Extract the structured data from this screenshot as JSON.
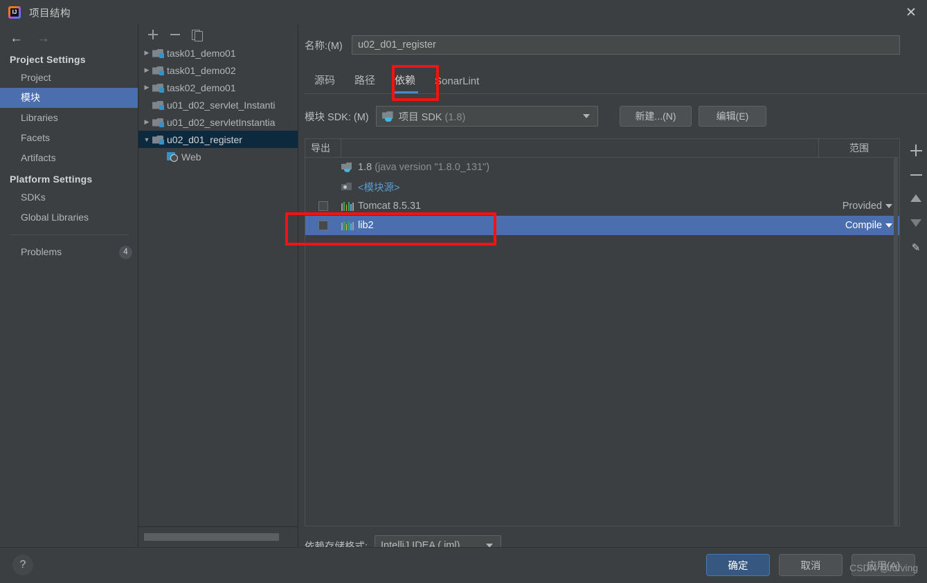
{
  "window": {
    "title": "项目结构",
    "logo_icon": "intellij-idea-logo",
    "close_icon": "close-icon"
  },
  "leftnav": {
    "back_icon": "arrow-left-icon",
    "forward_icon": "arrow-right-icon",
    "groups": [
      {
        "title": "Project Settings",
        "items": [
          {
            "label": "Project",
            "selected": false
          },
          {
            "label": "模块",
            "selected": true
          },
          {
            "label": "Libraries",
            "selected": false
          },
          {
            "label": "Facets",
            "selected": false
          },
          {
            "label": "Artifacts",
            "selected": false
          }
        ]
      },
      {
        "title": "Platform Settings",
        "items": [
          {
            "label": "SDKs",
            "selected": false
          },
          {
            "label": "Global Libraries",
            "selected": false
          }
        ]
      }
    ],
    "problems": {
      "label": "Problems",
      "count": "4"
    }
  },
  "tree": {
    "toolbar": {
      "add_icon": "plus-icon",
      "remove_icon": "minus-icon",
      "copy_icon": "copy-icon"
    },
    "rows": [
      {
        "label": "task01_demo01",
        "icon": "module-icon",
        "twisty": "▶",
        "indent": 0,
        "selected": false
      },
      {
        "label": "task01_demo02",
        "icon": "module-icon",
        "twisty": "▶",
        "indent": 0,
        "selected": false
      },
      {
        "label": "task02_demo01",
        "icon": "module-icon",
        "twisty": "▶",
        "indent": 0,
        "selected": false
      },
      {
        "label": "u01_d02_servlet_Instanti",
        "icon": "module-icon",
        "twisty": "",
        "indent": 0,
        "selected": false
      },
      {
        "label": "u01_d02_servletInstantia",
        "icon": "module-icon",
        "twisty": "▶",
        "indent": 0,
        "selected": false
      },
      {
        "label": "u02_d01_register",
        "icon": "module-icon",
        "twisty": "▼",
        "indent": 0,
        "selected": true
      },
      {
        "label": "Web",
        "icon": "web-facet-icon",
        "twisty": "",
        "indent": 1,
        "selected": false
      }
    ]
  },
  "module": {
    "name_label": "名称:(M)",
    "name_value": "u02_d01_register",
    "tabs": [
      {
        "label": "源码",
        "active": false
      },
      {
        "label": "路径",
        "active": false
      },
      {
        "label": "依赖",
        "active": true
      },
      {
        "label": "SonarLint",
        "active": false
      }
    ],
    "sdk_label": "模块 SDK: (M)",
    "sdk_value": "项目 SDK",
    "sdk_value_dim": "(1.8)",
    "sdk_icon": "jdk-icon",
    "new_button": "新建...(N)",
    "edit_button": "编辑(E)",
    "format_label": "依赖存储格式:",
    "format_value": "IntelliJ IDEA (.iml)"
  },
  "dependencies": {
    "columns": {
      "export": "导出",
      "scope": "范围"
    },
    "rows": [
      {
        "name": "1.8",
        "name_dim": "(java version \"1.8.0_131\")",
        "icon": "jdk-icon",
        "checkbox": false,
        "has_checkbox": false,
        "scope": "",
        "selected": false,
        "link": false
      },
      {
        "name": "<模块源>",
        "name_dim": "",
        "icon": "module-source-icon",
        "checkbox": false,
        "has_checkbox": false,
        "scope": "",
        "selected": false,
        "link": true
      },
      {
        "name": "Tomcat 8.5.31",
        "name_dim": "",
        "icon": "library-icon",
        "checkbox": false,
        "has_checkbox": true,
        "scope": "Provided",
        "selected": false,
        "link": false
      },
      {
        "name": "lib2",
        "name_dim": "",
        "icon": "library-icon",
        "checkbox": false,
        "has_checkbox": true,
        "scope": "Compile",
        "selected": true,
        "link": false
      }
    ],
    "toolbar": {
      "add_icon": "plus-icon",
      "remove_icon": "minus-icon",
      "move_up_icon": "arrow-up-icon",
      "move_down_icon": "arrow-down-icon",
      "edit_icon": "pencil-icon"
    }
  },
  "footer": {
    "help_icon": "help-question-icon",
    "ok": "确定",
    "cancel": "取消",
    "apply": "应用(A)"
  },
  "watermark": "CSDN @fdfving",
  "colors": {
    "background": "#3c3f41",
    "selection_blue": "#4b6eaf",
    "tree_selection": "#0d293e",
    "accent_tab": "#4a88c7",
    "annotation_red": "#f01414",
    "link_blue": "#5b9bd5",
    "ok_button": "#365880"
  }
}
